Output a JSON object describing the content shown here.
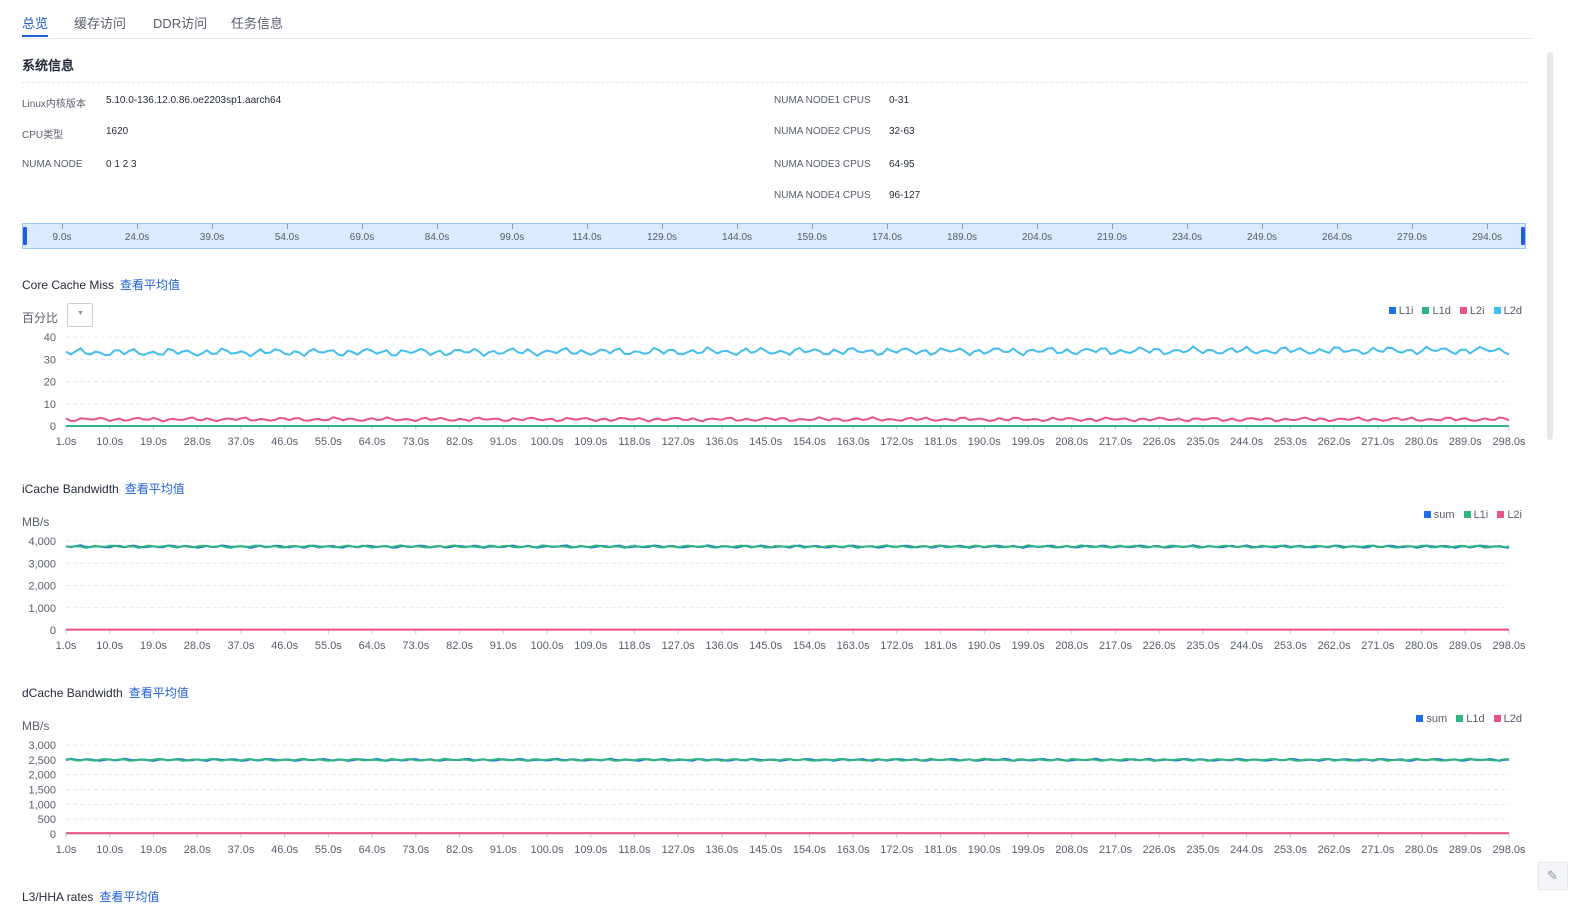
{
  "tabs": [
    {
      "label": "总览",
      "active": true
    },
    {
      "label": "缓存访问",
      "active": false
    },
    {
      "label": "DDR访问",
      "active": false
    },
    {
      "label": "任务信息",
      "active": false
    }
  ],
  "system_info": {
    "title": "系统信息",
    "left": [
      {
        "label": "Linux内核版本",
        "value": "5.10.0-136.12.0.86.oe2203sp1.aarch64"
      },
      {
        "label": "CPU类型",
        "value": "1620"
      },
      {
        "label": "NUMA NODE",
        "value": "0 1 2 3"
      }
    ],
    "right": [
      {
        "label": "NUMA NODE1 CPUS",
        "value": "0-31"
      },
      {
        "label": "NUMA NODE2 CPUS",
        "value": "32-63"
      },
      {
        "label": "NUMA NODE3 CPUS",
        "value": "64-95"
      },
      {
        "label": "NUMA NODE4 CPUS",
        "value": "96-127"
      }
    ]
  },
  "timeline": {
    "labels": [
      "9.0s",
      "24.0s",
      "39.0s",
      "54.0s",
      "69.0s",
      "84.0s",
      "99.0s",
      "114.0s",
      "129.0s",
      "144.0s",
      "159.0s",
      "174.0s",
      "189.0s",
      "204.0s",
      "219.0s",
      "234.0s",
      "249.0s",
      "264.0s",
      "279.0s",
      "294.0s"
    ]
  },
  "avg_link": "查看平均值",
  "x_labels": [
    "1.0s",
    "10.0s",
    "19.0s",
    "28.0s",
    "37.0s",
    "46.0s",
    "55.0s",
    "64.0s",
    "73.0s",
    "82.0s",
    "91.0s",
    "100.0s",
    "109.0s",
    "118.0s",
    "127.0s",
    "136.0s",
    "145.0s",
    "154.0s",
    "163.0s",
    "172.0s",
    "181.0s",
    "190.0s",
    "199.0s",
    "208.0s",
    "217.0s",
    "226.0s",
    "235.0s",
    "244.0s",
    "253.0s",
    "262.0s",
    "271.0s",
    "280.0s",
    "289.0s",
    "298.0s"
  ],
  "colors": {
    "blue": "#1e6fe8",
    "green": "#2fb57f",
    "pink": "#e8528a",
    "cyan": "#43bdf0",
    "teal": "#1fa79a"
  },
  "chart_data": [
    {
      "type": "line",
      "title": "Core Cache Miss",
      "unit": "百分比",
      "y_ticks": [
        "40",
        "30",
        "20",
        "10",
        "0"
      ],
      "ylim": [
        0,
        40
      ],
      "x": [
        "1.0s",
        "298.0s"
      ],
      "series": [
        {
          "name": "L1i",
          "color": "blue",
          "values": [
            0,
            0
          ]
        },
        {
          "name": "L1d",
          "color": "green",
          "values": [
            0,
            0
          ]
        },
        {
          "name": "L2i",
          "color": "pink",
          "values": [
            3,
            3
          ]
        },
        {
          "name": "L2d",
          "color": "cyan",
          "values": [
            33,
            34
          ]
        }
      ],
      "legend": "top-right",
      "grid": true
    },
    {
      "type": "line",
      "title": "iCache Bandwidth",
      "unit": "MB/s",
      "y_ticks": [
        "4,000",
        "3,000",
        "2,000",
        "1,000",
        "0"
      ],
      "ylim": [
        0,
        4000
      ],
      "x": [
        "1.0s",
        "298.0s"
      ],
      "series": [
        {
          "name": "sum",
          "color": "blue",
          "values": [
            3750,
            3750
          ]
        },
        {
          "name": "L1i",
          "color": "green",
          "values": [
            3750,
            3750
          ]
        },
        {
          "name": "L2i",
          "color": "pink",
          "values": [
            20,
            20
          ]
        }
      ],
      "legend": "top-right",
      "grid": true
    },
    {
      "type": "line",
      "title": "dCache Bandwidth",
      "unit": "MB/s",
      "y_ticks": [
        "3,000",
        "2,500",
        "2,000",
        "1,500",
        "1,000",
        "500",
        "0"
      ],
      "ylim": [
        0,
        3000
      ],
      "x": [
        "1.0s",
        "298.0s"
      ],
      "series": [
        {
          "name": "sum",
          "color": "blue",
          "values": [
            2500,
            2500
          ]
        },
        {
          "name": "L1d",
          "color": "green",
          "values": [
            2500,
            2500
          ]
        },
        {
          "name": "L2d",
          "color": "pink",
          "values": [
            30,
            30
          ]
        }
      ],
      "legend": "top-right",
      "grid": true
    }
  ],
  "next_section_title": "L3/HHA rates"
}
